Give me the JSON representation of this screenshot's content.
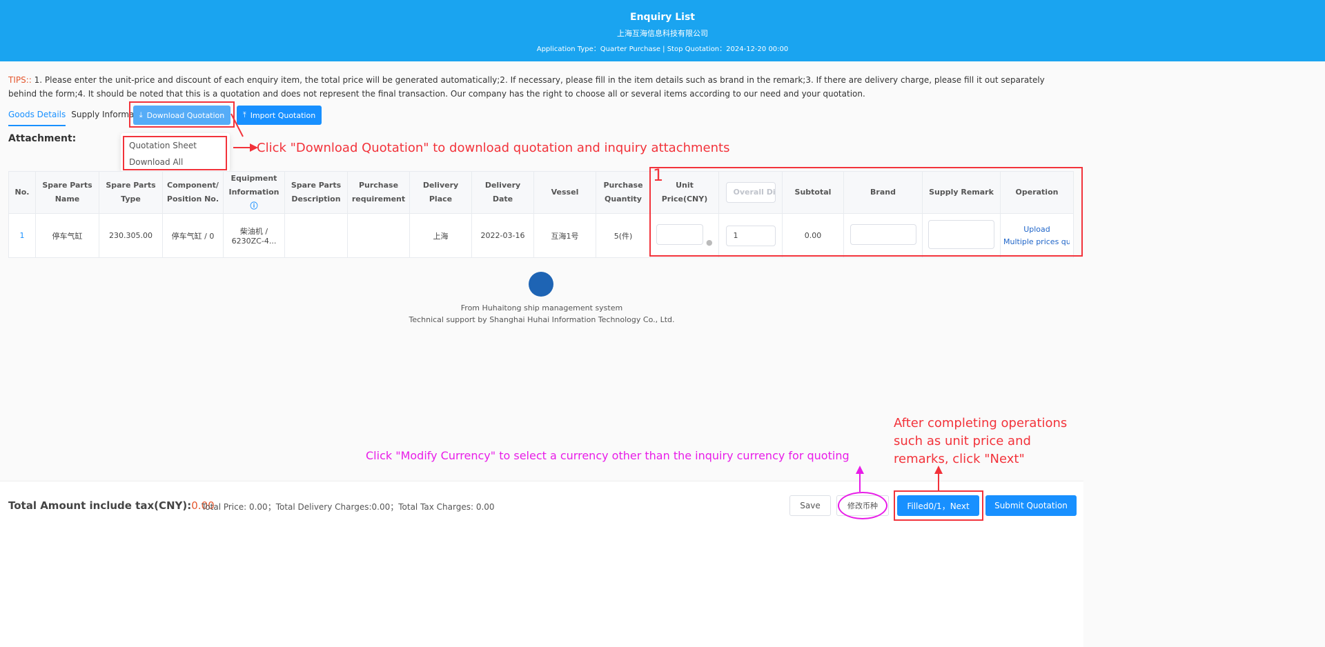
{
  "header": {
    "title": "Enquiry List",
    "company": "上海互海信息科技有限公司",
    "meta": "Application Type：Quarter Purchase | Stop Quotation：2024-12-20 00:00"
  },
  "tips": {
    "label": "TIPS::",
    "text": " 1. Please enter the unit-price and discount of each enquiry item, the total price will be generated automatically;2. If necessary, please fill in the item details such as brand in the remark;3. If there are delivery charge, please fill it out separately behind the form;4. It should be noted that this is a quotation and does not represent the final transaction. Our company has the right to choose all or several items according to our need and your quotation."
  },
  "tabs": [
    {
      "label": "Goods Details",
      "active": true
    },
    {
      "label": "Supply Information",
      "active": false
    }
  ],
  "buttons": {
    "download": "Download Quotation",
    "import": "Import Quotation",
    "save": "Save",
    "currency": "修改币种",
    "next": "Filled0/1，Next",
    "submit": "Submit Quotation"
  },
  "attachment_label": "Attachment:",
  "menu": [
    "Quotation Sheet",
    "Download All Attachments"
  ],
  "annotations": {
    "download": "Click \"Download Quotation\" to download quotation and inquiry attachments",
    "one": "1",
    "currency": "Click \"Modify Currency\" to select a currency other than the inquiry currency for quoting",
    "next": "After completing operations such as unit price and remarks, click \"Next\""
  },
  "table": {
    "headers": [
      "No.",
      "Spare Parts Name",
      "Spare Parts Type",
      "Component/ Position No.",
      "Equipment Information",
      "Spare Parts Description",
      "Purchase requirement",
      "Delivery Place",
      "Delivery Date",
      "Vessel",
      "Purchase Quantity",
      "Unit Price(CNY)",
      "",
      "Subtotal",
      "Brand",
      "Supply Remark",
      "Operation"
    ],
    "overall_placeholder": "Overall Discount",
    "rows": [
      {
        "no": "1",
        "name": "停车气缸",
        "type": "230.305.00",
        "component": "停车气缸 / 0",
        "equipment": "柴油机 / 6230ZC-4...",
        "description": "",
        "requirement": "",
        "place": "上海",
        "date": "2022-03-16",
        "vessel": "互海1号",
        "quantity": "5(件)",
        "unit_price": "",
        "discount": "1",
        "subtotal": "0.00",
        "brand": "",
        "remark": "",
        "ops": [
          "Upload",
          "Multiple prices quotation"
        ]
      }
    ]
  },
  "footer": {
    "line1": "From Huhaitong ship management system",
    "line2": "Technical support by Shanghai Huhai Information Technology Co., Ltd."
  },
  "totals": {
    "label": "Total Amount include tax(CNY):",
    "value": "0.00",
    "detail": "Total Price: 0.00；Total Delivery Charges:0.00；Total Tax Charges: 0.00"
  },
  "colors": {
    "header": "#1aa4f0",
    "primary": "#1890ff",
    "annotation": "#f2323a",
    "pink": "#e81ce8"
  }
}
